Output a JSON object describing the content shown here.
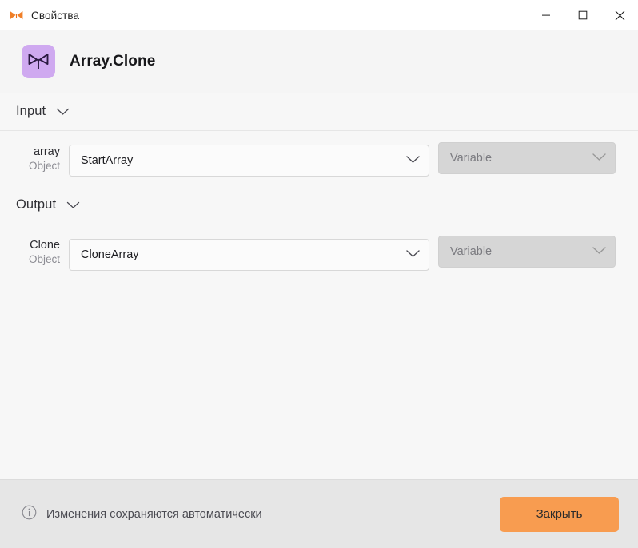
{
  "window": {
    "titlebar": {
      "app_icon": "butterfly-logo-icon",
      "title": "Свойства",
      "minimize_label": "—",
      "maximize_label": "□",
      "close_label": "✕"
    },
    "header": {
      "icon": "butterfly-activity-icon",
      "icon_bg": "#cfa9f0",
      "title": "Array.Clone"
    }
  },
  "sections": [
    {
      "id": "input",
      "label": "Input",
      "collapse_icon": "chevron-down-icon",
      "rows": [
        {
          "name": "array",
          "type": "Object",
          "value_field": {
            "value": "StartArray",
            "icon": "chevron-down-icon",
            "disabled": false
          },
          "mode_field": {
            "value": "Variable",
            "icon": "chevron-down-icon",
            "disabled": true
          }
        }
      ]
    },
    {
      "id": "output",
      "label": "Output",
      "collapse_icon": "chevron-down-icon",
      "rows": [
        {
          "name": "Clone",
          "type": "Object",
          "value_field": {
            "value": "CloneArray",
            "icon": "chevron-down-icon",
            "disabled": false
          },
          "mode_field": {
            "value": "Variable",
            "icon": "chevron-down-icon",
            "disabled": true
          }
        }
      ]
    }
  ],
  "footer": {
    "info_icon": "info-circle-icon",
    "note": "Изменения сохраняются автоматически",
    "close_button": "Закрыть",
    "close_button_color": "#f89c50"
  }
}
